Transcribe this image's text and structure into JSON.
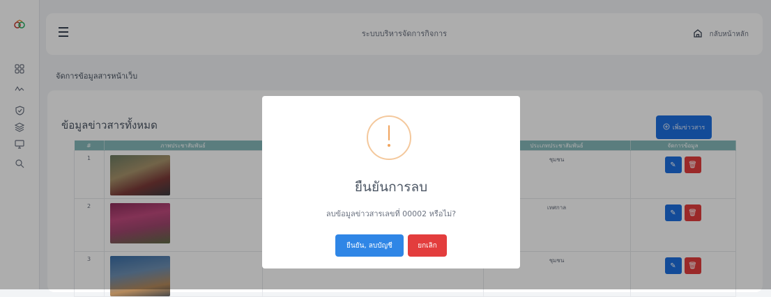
{
  "header": {
    "system_title": "ระบบบริหารจัดการกิจการ",
    "home_label": "กลับหน้าหลัก"
  },
  "breadcrumb": "จัดการข้อมูลสารหน้าเว็บ",
  "content": {
    "card_title": "ข้อมูลข่าวสารทั้งหมด",
    "add_button": "เพิ่มข่าวสาร",
    "columns": [
      "#",
      "ภาพประชาสัมพันธ์",
      "",
      "ประเภทประชาสัมพันธ์",
      "จัดการข้อมูล"
    ],
    "rows": [
      {
        "num": "1",
        "type": "ชุมชน"
      },
      {
        "num": "2",
        "type": "เทศกาล"
      },
      {
        "num": "3",
        "type": "ชุมชน"
      }
    ]
  },
  "modal": {
    "title": "ยืนยันการลบ",
    "message": "ลบข้อมูลข่าวสารเลขที่ 00002 หรือไม่?",
    "confirm_label": "ยืนยัน, ลบบัญชี",
    "cancel_label": "ยกเลิก"
  },
  "icons": [
    "logo",
    "dashboard-icon",
    "activity-icon",
    "shield-icon",
    "layers-icon",
    "monitor-icon",
    "search-icon",
    "home-icon",
    "plus-circle-icon",
    "pencil-icon",
    "trash-icon",
    "warning-icon"
  ],
  "colors": {
    "primary": "#1d6fe0",
    "danger": "#e33d3d",
    "table_header": "#85b8ba",
    "warning": "#f0a35c"
  }
}
